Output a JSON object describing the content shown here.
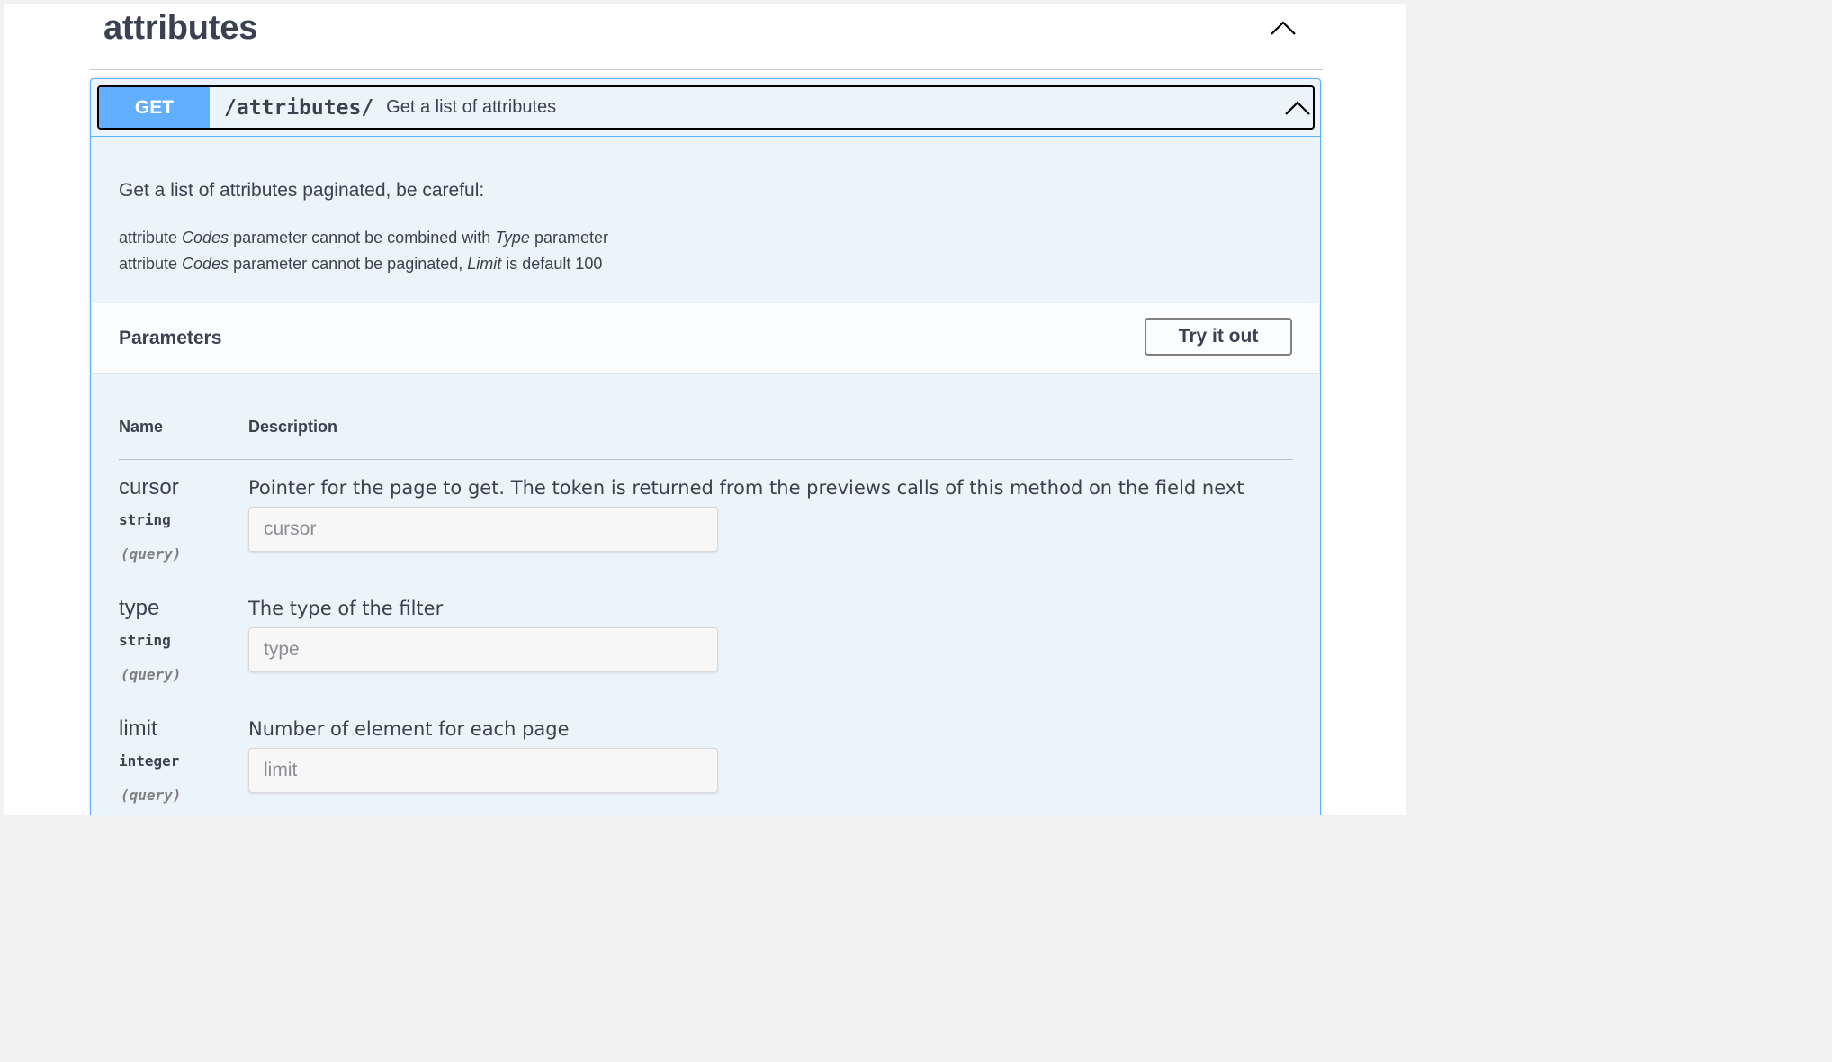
{
  "tag": {
    "title": "attributes",
    "toggle_icon": "chevron-up-icon"
  },
  "operation": {
    "method": "GET",
    "path": "/attributes/",
    "summary": "Get a list of attributes",
    "method_color": "#61affe",
    "toggle_icon": "chevron-up-icon"
  },
  "description": {
    "main": "Get a list of attributes paginated, be careful:",
    "line1": {
      "prefix": "attribute ",
      "em1": "Codes",
      "middle": " parameter cannot be combined with ",
      "em2": "Type",
      "suffix": " parameter"
    },
    "line2": {
      "prefix": "attribute ",
      "em1": "Codes",
      "middle": " parameter cannot be paginated, ",
      "em2": "Limit",
      "suffix": " is default 100"
    }
  },
  "parameters": {
    "title": "Parameters",
    "try_button": "Try it out",
    "col_name": "Name",
    "col_description": "Description",
    "items": [
      {
        "name": "cursor",
        "type": "string",
        "in": "(query)",
        "description": "Pointer for the page to get. The token is returned from the previews calls of this method on the field next",
        "placeholder": "cursor"
      },
      {
        "name": "type",
        "type": "string",
        "in": "(query)",
        "description": "The type of the filter",
        "placeholder": "type"
      },
      {
        "name": "limit",
        "type": "integer",
        "in": "(query)",
        "description": "Number of element for each page",
        "placeholder": "limit"
      }
    ]
  }
}
